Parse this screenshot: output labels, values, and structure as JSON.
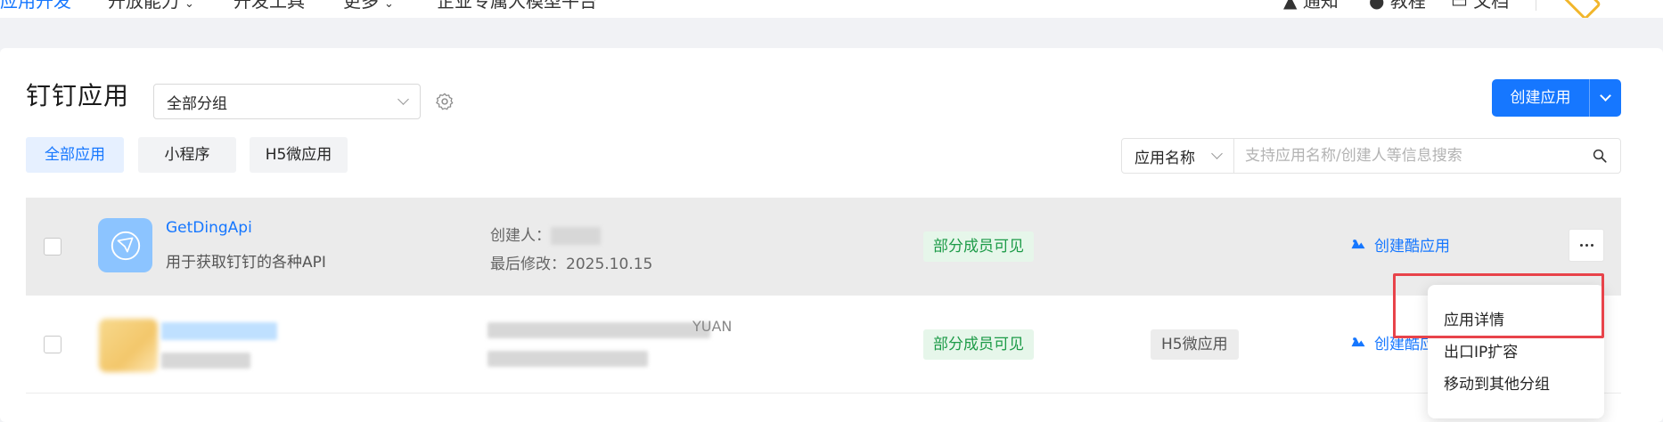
{
  "topnav": {
    "items": [
      {
        "label": "应用开发",
        "active": true
      },
      {
        "label": "开放能力",
        "has_caret": true
      },
      {
        "label": "开发工具"
      },
      {
        "label": "更多",
        "has_caret": true
      },
      {
        "label": "企业专属大模型平台"
      }
    ],
    "right": [
      "通知",
      "教程",
      "文档"
    ]
  },
  "page": {
    "title": "钉钉应用",
    "group_select": "全部分组",
    "create_label": "创建应用"
  },
  "filters": [
    "全部应用",
    "小程序",
    "H5微应用"
  ],
  "search": {
    "scope": "应用名称",
    "placeholder": "支持应用名称/创建人等信息搜索"
  },
  "apps": [
    {
      "name": "GetDingApi",
      "description": "用于获取钉钉的各种API",
      "creator_label": "创建人：",
      "modified_label": "最后修改：",
      "modified": "2025.10.15",
      "visibility": "部分成员可见",
      "action": "创建酷应用"
    },
    {
      "visibility": "部分成员可见",
      "type": "H5微应用",
      "action": "创建酷应用",
      "meta_fragment": "YUAN"
    }
  ],
  "menu": {
    "items": [
      "应用详情",
      "出口IP扩容",
      "移动到其他分组"
    ]
  },
  "colors": {
    "primary": "#1677ff",
    "success": "#1d9b48",
    "highlight": "#e8434a"
  }
}
